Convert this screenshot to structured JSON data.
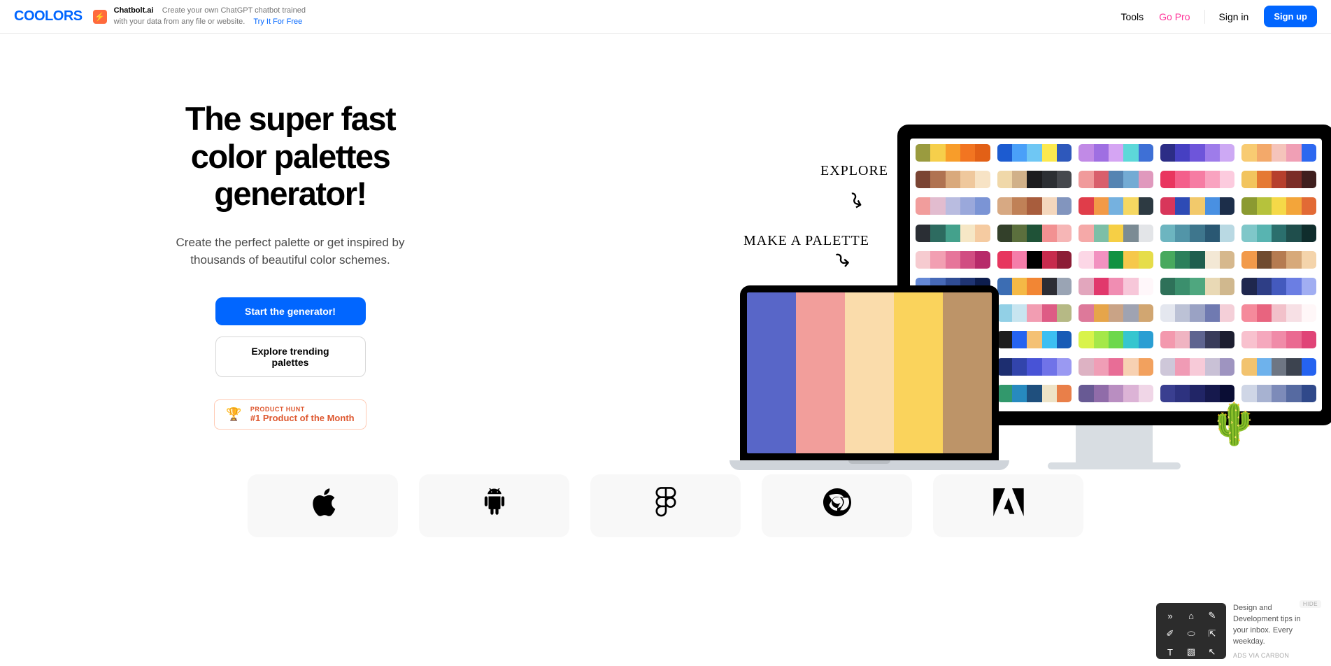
{
  "header": {
    "logo": "COOLORS",
    "ad": {
      "title": "Chatbolt.ai",
      "desc": "Create your own ChatGPT chatbot trained with your data from any file or website.",
      "link": "Try It For Free"
    },
    "nav": {
      "tools": "Tools",
      "goPro": "Go Pro",
      "signIn": "Sign in",
      "signUp": "Sign up"
    }
  },
  "hero": {
    "title": "The super fast color palettes generator!",
    "subtitle": "Create the perfect palette or get inspired by thousands of beautiful color schemes.",
    "primaryBtn": "Start the generator!",
    "secondaryBtn": "Explore trending palettes",
    "productHunt": {
      "top": "PRODUCT HUNT",
      "bottom": "#1 Product of the Month"
    },
    "handwritten": {
      "explore": "EXPLORE",
      "make": "MAKE A PALETTE"
    }
  },
  "laptopPalette": [
    "#5866c8",
    "#f29e9b",
    "#fadcab",
    "#fad35c",
    "#bd9468"
  ],
  "monitorPalettes": [
    [
      "#9a9b3f",
      "#f6cf4b",
      "#f89d2a",
      "#f27521",
      "#e26016"
    ],
    [
      "#1c5bd0",
      "#4aa0f8",
      "#6fc7f4",
      "#fce94f",
      "#2e58bb"
    ],
    [
      "#c18ae6",
      "#9f6fe2",
      "#d5a5f3",
      "#5dd8d9",
      "#3e70d6"
    ],
    [
      "#2c2d86",
      "#4640c2",
      "#6e55da",
      "#9e7cea",
      "#cda9f4"
    ],
    [
      "#f8cb72",
      "#f3a96a",
      "#f5c4bb",
      "#f09fb5",
      "#2d68f0"
    ],
    [
      "#7a4433",
      "#b07351",
      "#d9a97c",
      "#efc89d",
      "#f7e3c5"
    ],
    [
      "#f0d8a9",
      "#d1b189",
      "#1c1c1e",
      "#2c2f33",
      "#45484d"
    ],
    [
      "#f09a9b",
      "#d95f6c",
      "#5584b2",
      "#73abd4",
      "#e099bd"
    ],
    [
      "#e9355f",
      "#f45f8b",
      "#f67ca3",
      "#f9a3c0",
      "#fccbde"
    ],
    [
      "#f2c45e",
      "#e57934",
      "#b63f2d",
      "#7b2d27",
      "#3f1f1e"
    ],
    [
      "#f19d9c",
      "#e2bccf",
      "#b9bce0",
      "#9aa8db",
      "#7b94d5"
    ],
    [
      "#d7a983",
      "#c08157",
      "#a85d3d",
      "#f4d7bd",
      "#8295be"
    ],
    [
      "#e03d4a",
      "#f29a47",
      "#75b1df",
      "#f6d861",
      "#2d3a42"
    ],
    [
      "#d8365a",
      "#2e4bb5",
      "#f2c96b",
      "#4990e2",
      "#1c2e4a"
    ],
    [
      "#8b9a31",
      "#b6c23c",
      "#f5d948",
      "#f3a53a",
      "#e26a35"
    ],
    [
      "#2a2e34",
      "#2d6b60",
      "#44a18c",
      "#f6e7c6",
      "#f5cba1"
    ],
    [
      "#33402a",
      "#5b6f3d",
      "#1f5237",
      "#f29192",
      "#f6b6b6"
    ],
    [
      "#f5a9a8",
      "#7dbfa7",
      "#f6cf45",
      "#7b8b94",
      "#e3e5e8"
    ],
    [
      "#6db5c0",
      "#5295a8",
      "#3e768d",
      "#2a5873",
      "#b9d9e3"
    ],
    [
      "#7fc7c9",
      "#58b4b1",
      "#2b6f6d",
      "#1f4e4c",
      "#0f2d2c"
    ],
    [
      "#f6cbd0",
      "#f29fb2",
      "#e6759a",
      "#d14d82",
      "#b72a6a"
    ],
    [
      "#e7365e",
      "#f57daa",
      "#000000",
      "#c72b4d",
      "#8c1d36"
    ],
    [
      "#fcd7e6",
      "#f291c0",
      "#129242",
      "#f6c84b",
      "#e6dd4a"
    ],
    [
      "#48a95e",
      "#2c805b",
      "#1f5e4e",
      "#f3e8d5",
      "#d6b88d"
    ],
    [
      "#f29a4a",
      "#704b2f",
      "#b57b51",
      "#d7a97a",
      "#f4d4ab"
    ],
    [
      "#6488d5",
      "#4669b7",
      "#2f4c94",
      "#1f3473",
      "#0d1d4e"
    ],
    [
      "#3c6db3",
      "#f4b946",
      "#f28634",
      "#2d2d34",
      "#9aa4b4"
    ],
    [
      "#e2a6bd",
      "#e1386c",
      "#f08db2",
      "#f7c7d9",
      "#fff7fa"
    ],
    [
      "#2e7159",
      "#3b8f6d",
      "#4fa77f",
      "#e9d9b5",
      "#d0b88e"
    ],
    [
      "#1f274e",
      "#2e3e86",
      "#445abe",
      "#6b7ee3",
      "#a1aef2"
    ],
    [
      "#d89739",
      "#f0b247",
      "#fad572",
      "#fde6a3",
      "#fef3d3"
    ],
    [
      "#92d0e6",
      "#c8e5f0",
      "#f29db2",
      "#de5c85",
      "#b6b985"
    ],
    [
      "#dd799a",
      "#e6a54a",
      "#c9a386",
      "#9fa3b2",
      "#d1a671"
    ],
    [
      "#e4e7ef",
      "#bcc2d6",
      "#9aa2c4",
      "#707ab1",
      "#f4cfd8"
    ],
    [
      "#f58a9b",
      "#e8647f",
      "#f2c1ca",
      "#f7e0e5",
      "#fff7f8"
    ],
    [
      "#e77c2c",
      "#f4b550",
      "#2a5032",
      "#1f3e28",
      "#111f14"
    ],
    [
      "#1e1e1e",
      "#2563f0",
      "#f4c174",
      "#3cbff2",
      "#175bb6"
    ],
    [
      "#d9f34b",
      "#a5e849",
      "#6dd84c",
      "#36c6cf",
      "#2a9ed3"
    ],
    [
      "#f399ae",
      "#f0b4c2",
      "#5e6490",
      "#383b5a",
      "#1c1e30"
    ],
    [
      "#f8c1ce",
      "#f5a8bd",
      "#f08ba8",
      "#ea6a91",
      "#e04477"
    ],
    [
      "#1e2533",
      "#2f3e5a",
      "#b36fd6",
      "#45d7f2",
      "#6fe3f3"
    ],
    [
      "#1d2e70",
      "#3244ab",
      "#4853d6",
      "#7073e8",
      "#9a99f2"
    ],
    [
      "#ddb2c3",
      "#f09eb6",
      "#e86d96",
      "#f7d1b2",
      "#f2a15e"
    ],
    [
      "#cec7d9",
      "#f09bb5",
      "#f7cad8",
      "#c9c1d6",
      "#9e94c0"
    ],
    [
      "#f2c36f",
      "#6eb2ec",
      "#6e7683",
      "#3c434f",
      "#2563f0"
    ],
    [
      "#f79e71",
      "#b1b85a",
      "#4aa08d",
      "#2d6c9e",
      "#1c3e75"
    ],
    [
      "#32986c",
      "#278abf",
      "#1f4f7d",
      "#eee3c7",
      "#e97f49"
    ],
    [
      "#685a94",
      "#906ca9",
      "#b98ec1",
      "#dcb3d6",
      "#f0d6e7"
    ],
    [
      "#3a3f90",
      "#2d327f",
      "#212566",
      "#16194d",
      "#0a0d34"
    ],
    [
      "#cfd6e6",
      "#a7b2d1",
      "#7d8bb9",
      "#566aa1",
      "#30498a"
    ]
  ],
  "carbonAd": {
    "text": "Design and Development tips in your inbox. Every weekday.",
    "via": "ADS VIA CARBON",
    "hide": "HIDE"
  }
}
